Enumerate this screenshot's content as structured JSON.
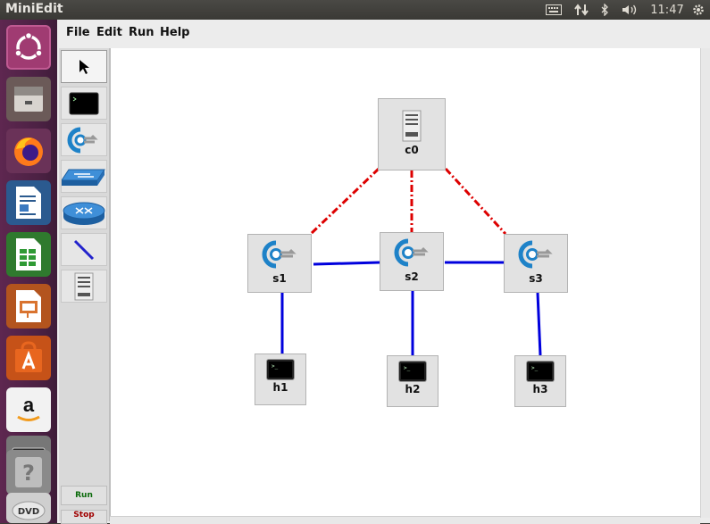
{
  "system": {
    "window_title": "MiniEdit",
    "clock": "11:47"
  },
  "menu": [
    {
      "label": "File"
    },
    {
      "label": "Edit"
    },
    {
      "label": "Run"
    },
    {
      "label": "Help"
    }
  ],
  "palette": {
    "run_label": "Run",
    "stop_label": "Stop"
  },
  "canvas": {
    "nodes": {
      "c0": {
        "label": "c0"
      },
      "s1": {
        "label": "s1"
      },
      "s2": {
        "label": "s2"
      },
      "s3": {
        "label": "s3"
      },
      "h1": {
        "label": "h1"
      },
      "h2": {
        "label": "h2"
      },
      "h3": {
        "label": "h3"
      }
    },
    "colors": {
      "data_link": "#0000dd",
      "control_link": "#dd0000"
    }
  }
}
